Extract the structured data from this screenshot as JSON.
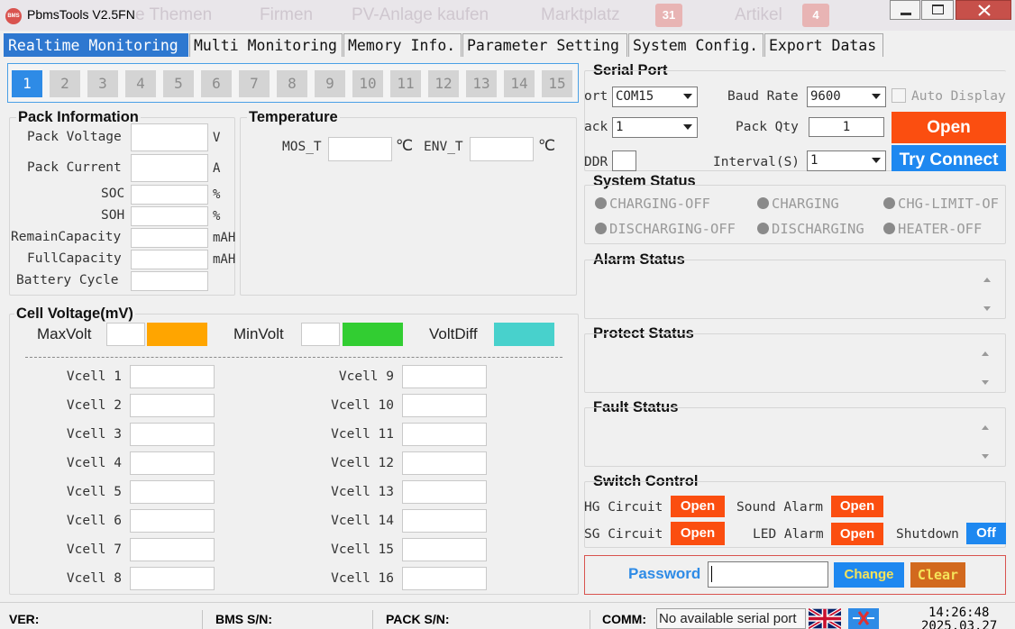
{
  "app": {
    "title": "PbmsTools V2.5FN",
    "logo_text": "BMS",
    "background_text": [
      "e Themen",
      "Firmen",
      "PV-Anlage kaufen",
      "Marktplatz",
      "Artikel"
    ],
    "background_badges": [
      "31",
      "4"
    ]
  },
  "tabs": [
    "Realtime Monitoring",
    "Multi Monitoring",
    "Memory Info.",
    "Parameter Setting",
    "System Config.",
    "Export Datas"
  ],
  "packs": [
    "1",
    "2",
    "3",
    "4",
    "5",
    "6",
    "7",
    "8",
    "9",
    "10",
    "11",
    "12",
    "13",
    "14",
    "15"
  ],
  "pack_info": {
    "title": "Pack Information",
    "fields": [
      {
        "label": "Pack Voltage",
        "unit": "V"
      },
      {
        "label": "Pack Current",
        "unit": "A"
      },
      {
        "label": "SOC",
        "unit": "%"
      },
      {
        "label": "SOH",
        "unit": "%"
      },
      {
        "label": "RemainCapacity",
        "unit": "mAH"
      },
      {
        "label": "FullCapacity",
        "unit": "mAH"
      },
      {
        "label": "Battery Cycle",
        "unit": ""
      }
    ]
  },
  "temperature": {
    "title": "Temperature",
    "mos_label": "MOS_T",
    "env_label": "ENV_T",
    "unit": "℃"
  },
  "cell_voltage": {
    "title": "Cell Voltage(mV)",
    "max_label": "MaxVolt",
    "min_label": "MinVolt",
    "diff_label": "VoltDiff",
    "max_color": "#ffa500",
    "min_color": "#32cd32",
    "diff_color": "#48d1cc",
    "cells": [
      "Vcell 1",
      "Vcell 2",
      "Vcell 3",
      "Vcell 4",
      "Vcell 5",
      "Vcell 6",
      "Vcell 7",
      "Vcell 8",
      "Vcell 9",
      "Vcell 10",
      "Vcell 11",
      "Vcell 12",
      "Vcell 13",
      "Vcell 14",
      "Vcell 15",
      "Vcell 16"
    ]
  },
  "serial": {
    "title": "Serial Port",
    "port_label": "ort",
    "port_value": "COM15",
    "baud_label": "Baud Rate",
    "baud_value": "9600",
    "auto_display_label": "Auto Display",
    "pack_label": "ack",
    "pack_value": "1",
    "pack_qty_label": "Pack Qty",
    "pack_qty_value": "1",
    "open_label": "Open",
    "addr_label": "DDR",
    "interval_label": "Interval(S)",
    "interval_value": "1",
    "try_connect_label": "Try Connect"
  },
  "system_status": {
    "title": "System Status",
    "items": [
      "CHARGING-OFF",
      "CHARGING",
      "CHG-LIMIT-OF",
      "DISCHARGING-OFF",
      "DISCHARGING",
      "HEATER-OFF"
    ]
  },
  "alarm_status": {
    "title": "Alarm Status"
  },
  "protect_status": {
    "title": "Protect Status"
  },
  "fault_status": {
    "title": "Fault Status"
  },
  "switch_control": {
    "title": "Switch Control",
    "chg_label": "HG Circuit",
    "chg_value": "Open",
    "sound_label": "Sound Alarm",
    "sound_value": "Open",
    "dsg_label": "SG Circuit",
    "dsg_value": "Open",
    "led_label": "LED Alarm",
    "led_value": "Open",
    "shutdown_label": "Shutdown",
    "shutdown_value": "Off"
  },
  "password": {
    "label": "Password",
    "value": "",
    "change_label": "Change",
    "clear_label": "Clear"
  },
  "statusbar": {
    "ver_label": "VER:",
    "bms_sn_label": "BMS S/N:",
    "pack_sn_label": "PACK S/N:",
    "comm_label": "COMM:",
    "comm_value": "No available serial port",
    "time": "14:26:48",
    "date": "2025.03.27"
  }
}
